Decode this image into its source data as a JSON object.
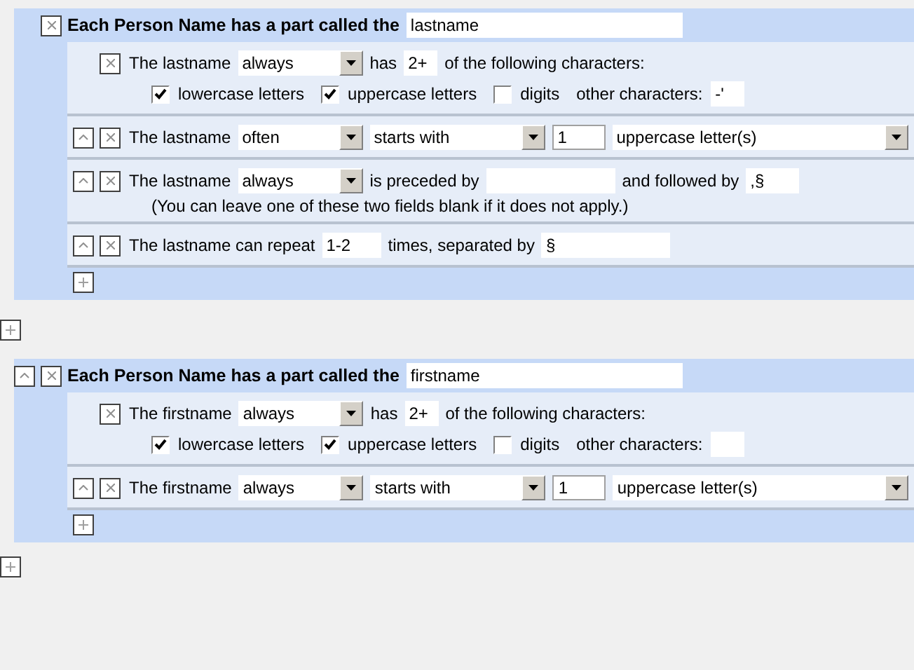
{
  "parts": [
    {
      "can_move_up": false,
      "label": "Each Person Name has a part called the",
      "name": "lastname",
      "rules": [
        {
          "kind": "characters",
          "can_move_up": false,
          "subject": "The lastname",
          "frequency": "always",
          "verb": "has",
          "count": "2+",
          "tail": "of the following characters:",
          "options": [
            {
              "label": "lowercase letters",
              "checked": true
            },
            {
              "label": "uppercase letters",
              "checked": true
            },
            {
              "label": "digits",
              "checked": false
            }
          ],
          "other_label": "other characters:",
          "other_value": "-'"
        },
        {
          "kind": "starts_with",
          "can_move_up": true,
          "subject": "The lastname",
          "frequency": "often",
          "relation": "starts with",
          "count": "1",
          "unit": "uppercase letter(s)"
        },
        {
          "kind": "surrounded",
          "can_move_up": true,
          "subject": "The lastname",
          "frequency": "always",
          "relation": "is preceded by",
          "followed_label": "and followed by",
          "after": ",§",
          "note": "(You can leave one of these two fields blank if it does not apply.)"
        },
        {
          "kind": "repeat",
          "can_move_up": true,
          "subject": "The lastname can repeat",
          "count": "1-2",
          "tail": "times, separated by",
          "separator": "§"
        }
      ]
    },
    {
      "can_move_up": true,
      "label": "Each Person Name has a part called the",
      "name": "firstname",
      "rules": [
        {
          "kind": "characters",
          "can_move_up": false,
          "subject": "The firstname",
          "frequency": "always",
          "verb": "has",
          "count": "2+",
          "tail": "of the following characters:",
          "options": [
            {
              "label": "lowercase letters",
              "checked": true
            },
            {
              "label": "uppercase letters",
              "checked": true
            },
            {
              "label": "digits",
              "checked": false
            }
          ],
          "other_label": "other characters:"
        },
        {
          "kind": "starts_with",
          "can_move_up": true,
          "subject": "The firstname",
          "frequency": "always",
          "relation": "starts with",
          "count": "1",
          "unit": "uppercase letter(s)"
        }
      ]
    }
  ]
}
